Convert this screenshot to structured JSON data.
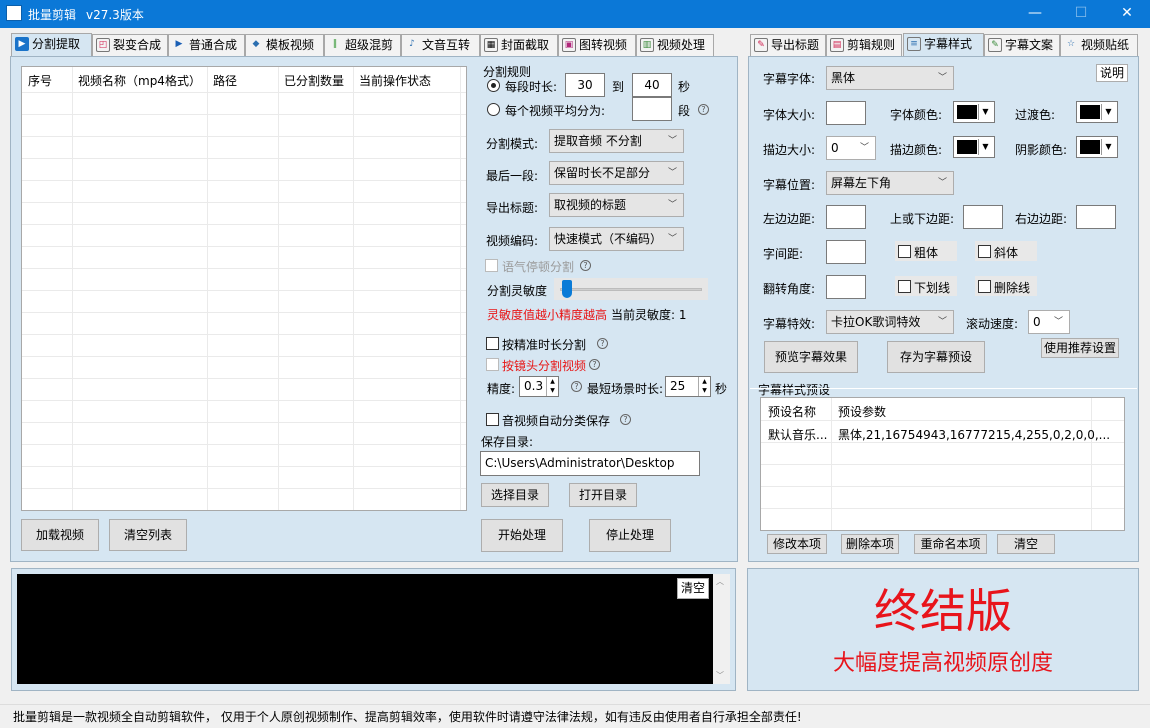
{
  "window": {
    "title": "批量剪辑",
    "version": "v27.3版本",
    "minimize": "—",
    "maximize": "☐",
    "close": "✕"
  },
  "left_tabs": [
    {
      "label": "分割提取",
      "icon": "▶"
    },
    {
      "label": "裂变合成",
      "icon": "◰"
    },
    {
      "label": "普通合成",
      "icon": "▶"
    },
    {
      "label": "模板视频",
      "icon": "◆"
    },
    {
      "label": "超级混剪",
      "icon": "‖"
    },
    {
      "label": "文音互转",
      "icon": "♪"
    },
    {
      "label": "封面截取",
      "icon": "▦"
    },
    {
      "label": "图转视频",
      "icon": "▣"
    },
    {
      "label": "视频处理",
      "icon": "▥"
    }
  ],
  "right_tabs": [
    {
      "label": "导出标题",
      "icon": "✎"
    },
    {
      "label": "剪辑规则",
      "icon": "▤"
    },
    {
      "label": "字幕样式",
      "icon": "≡"
    },
    {
      "label": "字幕文案",
      "icon": "✎"
    },
    {
      "label": "视频贴纸",
      "icon": "☆"
    }
  ],
  "table": {
    "columns": [
      "序号",
      "视频名称（mp4格式）",
      "路径",
      "已分割数量",
      "当前操作状态"
    ]
  },
  "left_buttons": {
    "load": "加载视频",
    "clear": "清空列表"
  },
  "split": {
    "rule_title": "分割规则",
    "per_segment_label": "每段时长:",
    "from": "30",
    "to_label": "到",
    "to": "40",
    "sec": "秒",
    "avg_label": "每个视频平均分为:",
    "avg_value": "",
    "seg": "段",
    "mode_label": "分割模式:",
    "mode_value": "提取音频 不分割",
    "last_label": "最后一段:",
    "last_value": "保留时长不足部分",
    "title_label": "导出标题:",
    "title_value": "取视频的标题",
    "codec_label": "视频编码:",
    "codec_value": "快速模式（不编码）",
    "pause_label": "语气停顿分割",
    "sens_label": "分割灵敏度",
    "sens_hint": "灵敏度值越小精度越高",
    "sens_current": "当前灵敏度: 1",
    "sens_level": 0.0,
    "precise_label": "按精准时长分割",
    "shot_label": "按镜头分割视频",
    "precision_label": "精度:",
    "precision_value": "0.3",
    "shortest_label": "最短场景时长:",
    "shortest_value": "25",
    "shortest_unit": "秒",
    "auto_label": "音视频自动分类保存",
    "save_label": "保存目录:",
    "save_path": "C:\\Users\\Administrator\\Desktop",
    "choose_dir": "选择目录",
    "open_dir": "打开目录",
    "start": "开始处理",
    "stop": "停止处理"
  },
  "subtitle": {
    "font_label": "字幕字体:",
    "font_value": "黑体",
    "help": "说明",
    "size_label": "字体大小:",
    "size_value": "",
    "color_label": "字体颜色:",
    "trans_label": "过渡色:",
    "stroke_label": "描边大小:",
    "stroke_value": "0",
    "stroke_color_label": "描边颜色:",
    "shadow_label": "阴影颜色:",
    "pos_label": "字幕位置:",
    "pos_value": "屏幕左下角",
    "left_margin": "左边边距:",
    "tb_margin": "上或下边距:",
    "right_margin": "右边边距:",
    "spacing": "字间距:",
    "bold": "粗体",
    "italic": "斜体",
    "rotate": "翻转角度:",
    "underline": "下划线",
    "strike": "删除线",
    "effect_label": "字幕特效:",
    "effect_value": "卡拉OK歌词特效",
    "speed_label": "滚动速度:",
    "speed_value": "0",
    "preview": "预览字幕效果",
    "save_preset": "存为字幕预设",
    "recommend": "使用推荐设置"
  },
  "presets": {
    "title": "字幕样式预设",
    "columns": [
      "预设名称",
      "预设参数"
    ],
    "rows": [
      {
        "name": "默认音乐...",
        "params": "黑体,21,16754943,16777215,4,255,0,2,0,0,..."
      }
    ],
    "modify": "修改本项",
    "delete": "删除本项",
    "rename": "重命名本项",
    "clear": "清空"
  },
  "log": {
    "clear": "清空"
  },
  "promo": {
    "title": "终结版",
    "subtitle": "大幅度提高视频原创度",
    "color": "#e8141b"
  },
  "status": "批量剪辑是一款视频全自动剪辑软件， 仅用于个人原创视频制作、提高剪辑效率，使用软件时请遵守法律法规，如有违反由使用者自行承担全部责任!"
}
